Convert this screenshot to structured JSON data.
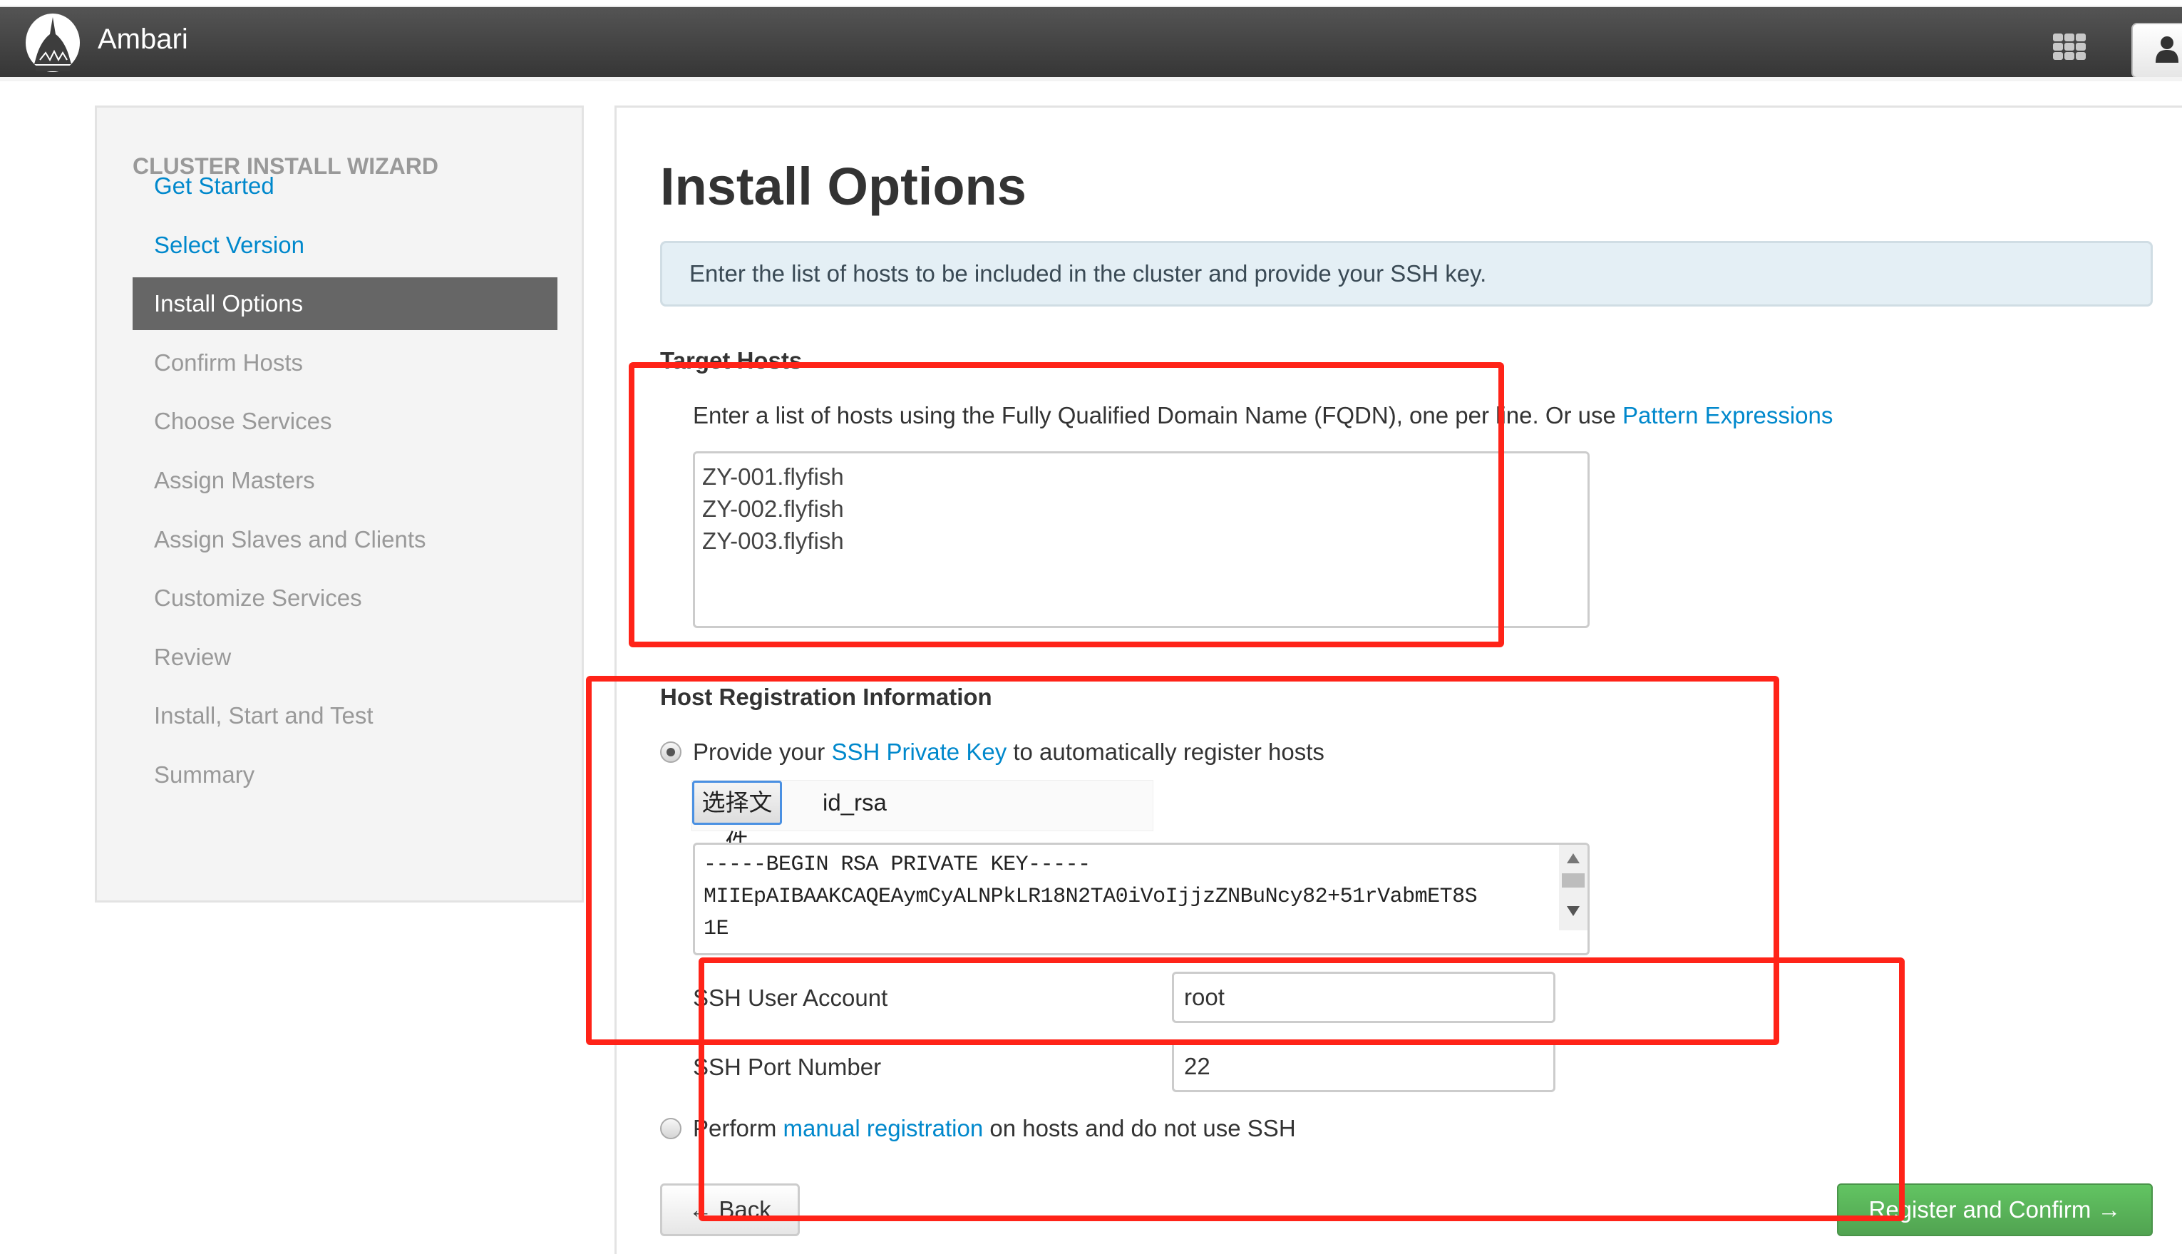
{
  "navbar": {
    "brand": "Ambari",
    "apps_icon": "grid-icon",
    "user_icon": "user-icon"
  },
  "sidebar": {
    "title": "CLUSTER INSTALL WIZARD",
    "steps": [
      {
        "label": "Get Started",
        "state": "done"
      },
      {
        "label": "Select Version",
        "state": "done"
      },
      {
        "label": "Install Options",
        "state": "active"
      },
      {
        "label": "Confirm Hosts",
        "state": "pending"
      },
      {
        "label": "Choose Services",
        "state": "pending"
      },
      {
        "label": "Assign Masters",
        "state": "pending"
      },
      {
        "label": "Assign Slaves and Clients",
        "state": "pending"
      },
      {
        "label": "Customize Services",
        "state": "pending"
      },
      {
        "label": "Review",
        "state": "pending"
      },
      {
        "label": "Install, Start and Test",
        "state": "pending"
      },
      {
        "label": "Summary",
        "state": "pending"
      }
    ]
  },
  "main": {
    "title": "Install Options",
    "alert": "Enter the list of hosts to be included in the cluster and provide your SSH key.",
    "target_hosts": {
      "heading": "Target Hosts",
      "desc_prefix": "Enter a list of hosts using the Fully Qualified Domain Name (FQDN), one per line. Or use ",
      "desc_link": "Pattern Expressions",
      "hosts_value": "ZY-001.flyfish\nZY-002.flyfish\nZY-003.flyfish"
    },
    "host_registration": {
      "heading": "Host Registration Information",
      "ssh_option": {
        "prefix": "Provide your ",
        "link": "SSH Private Key",
        "suffix": " to automatically register hosts",
        "checked": true
      },
      "file_button": "选择文件",
      "file_name": "id_rsa",
      "private_key_value": "-----BEGIN RSA PRIVATE KEY-----\nMIIEpAIBAAKCAQEAymCyALNPkLR18N2TA0iVoIjjzZNBuNcy82+51rVabmET8S\n1E",
      "ssh_user_label": "SSH User Account",
      "ssh_user_value": "root",
      "ssh_port_label": "SSH Port Number",
      "ssh_port_value": "22",
      "manual_option": {
        "prefix": "Perform ",
        "link": "manual registration",
        "suffix": " on hosts and do not use SSH",
        "checked": false
      }
    },
    "buttons": {
      "back": "← Back",
      "next": "Register and Confirm →"
    }
  },
  "colors": {
    "link": "#0088cc",
    "active_step_bg": "#666666",
    "primary_button": "#5bb75b",
    "annotation": "#ff2318"
  }
}
